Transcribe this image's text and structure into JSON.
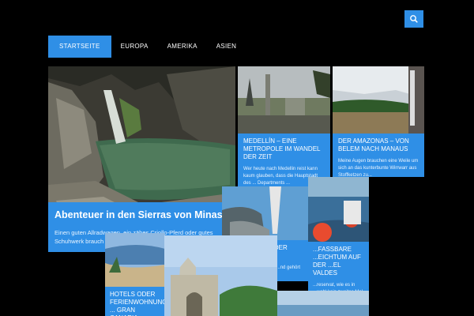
{
  "nav": {
    "items": [
      {
        "label": "STARTSEITE",
        "active": true
      },
      {
        "label": "EUROPA"
      },
      {
        "label": "AMERIKA"
      },
      {
        "label": "ASIEN"
      }
    ]
  },
  "search": {
    "icon": "search-icon"
  },
  "posts": {
    "minas": {
      "title": "Abenteuer in den Sierras von Minas",
      "excerpt": "Einen guten Allradwagen, ein zähes Criollo-Pferd oder gutes Schuhwerk brauch"
    },
    "medellin": {
      "title": "MEDELLÍN – EINE METROPOLE IM WANDEL DER ZEIT",
      "excerpt": "Wer heute nach Medellin reist kann kaum glauben, dass die Hauptstadt des ... Departments ..."
    },
    "amazonas": {
      "title": "DER AMAZONAS – VON BELEM NACH MANAUS",
      "excerpt": "Meine Augen brauchen eine Weile um sich an das kunterbunte Wirrwarr aus Stoffketzen zu..."
    },
    "insel": {
      "title": "...FA DIE INSEL DER ...EILIGEN",
      "excerpt": "...t die größte Insel der ...nd gehört zu Spanien. ...nd..."
    },
    "valdes": {
      "title": "...FASSBARE ...EICHTUM AUF DER ...EL VALDES",
      "excerpt": "...reservat, wie es in ...wohl kein zweites Mal"
    },
    "canaria": {
      "title": "HOTELS ODER FERIENWOHNUNG ... GRAN CANARIA"
    }
  }
}
